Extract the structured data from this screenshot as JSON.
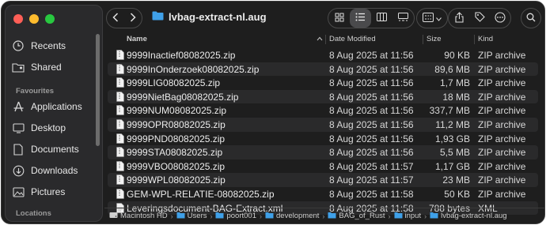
{
  "sidebar": {
    "items_top": [
      {
        "label": "Recents",
        "icon": "clock-icon"
      },
      {
        "label": "Shared",
        "icon": "shared-folder-icon"
      }
    ],
    "section_favourites": "Favourites",
    "favourites": [
      {
        "label": "Applications",
        "icon": "applications-icon"
      },
      {
        "label": "Desktop",
        "icon": "desktop-icon"
      },
      {
        "label": "Documents",
        "icon": "document-icon"
      },
      {
        "label": "Downloads",
        "icon": "download-icon"
      },
      {
        "label": "Pictures",
        "icon": "pictures-icon"
      }
    ],
    "section_locations": "Locations"
  },
  "toolbar": {
    "title": "lvbag-extract-nl.aug"
  },
  "columns": {
    "name": "Name",
    "date": "Date Modified",
    "size": "Size",
    "kind": "Kind"
  },
  "files": [
    {
      "name": "9999Inactief08082025.zip",
      "date": "8 Aug 2025 at 11:56",
      "size": "90 KB",
      "kind": "ZIP archive"
    },
    {
      "name": "9999InOnderzoek08082025.zip",
      "date": "8 Aug 2025 at 11:56",
      "size": "89,6 MB",
      "kind": "ZIP archive"
    },
    {
      "name": "9999LIG08082025.zip",
      "date": "8 Aug 2025 at 11:56",
      "size": "1,7 MB",
      "kind": "ZIP archive"
    },
    {
      "name": "9999NietBag08082025.zip",
      "date": "8 Aug 2025 at 11:56",
      "size": "18 MB",
      "kind": "ZIP archive"
    },
    {
      "name": "9999NUM08082025.zip",
      "date": "8 Aug 2025 at 11:56",
      "size": "337,7 MB",
      "kind": "ZIP archive"
    },
    {
      "name": "9999OPR08082025.zip",
      "date": "8 Aug 2025 at 11:56",
      "size": "11,2 MB",
      "kind": "ZIP archive"
    },
    {
      "name": "9999PND08082025.zip",
      "date": "8 Aug 2025 at 11:56",
      "size": "1,93 GB",
      "kind": "ZIP archive"
    },
    {
      "name": "9999STA08082025.zip",
      "date": "8 Aug 2025 at 11:56",
      "size": "5,5 MB",
      "kind": "ZIP archive"
    },
    {
      "name": "9999VBO08082025.zip",
      "date": "8 Aug 2025 at 11:57",
      "size": "1,17 GB",
      "kind": "ZIP archive"
    },
    {
      "name": "9999WPL08082025.zip",
      "date": "8 Aug 2025 at 11:57",
      "size": "23 MB",
      "kind": "ZIP archive"
    },
    {
      "name": "GEM-WPL-RELATIE-08082025.zip",
      "date": "8 Aug 2025 at 11:58",
      "size": "50 KB",
      "kind": "ZIP archive"
    },
    {
      "name": "Leveringsdocument-BAG-Extract.xml",
      "date": "8 Aug 2025 at 11:58",
      "size": "788 bytes",
      "kind": "XML"
    }
  ],
  "pathbar": [
    {
      "label": "Macintosh HD",
      "icon": "disk-icon"
    },
    {
      "label": "Users",
      "icon": "folder-icon"
    },
    {
      "label": "poort001",
      "icon": "folder-icon"
    },
    {
      "label": "development",
      "icon": "folder-icon"
    },
    {
      "label": "BAG_of_Rust",
      "icon": "folder-icon"
    },
    {
      "label": "input",
      "icon": "folder-icon"
    },
    {
      "label": "lvbag-extract-nl.aug",
      "icon": "folder-icon"
    }
  ],
  "colors": {
    "folder": "#3fa0e8",
    "icon": "#d8d8d8"
  }
}
